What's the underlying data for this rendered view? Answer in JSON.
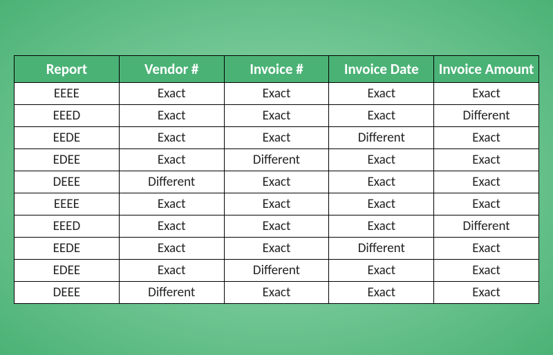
{
  "chart_data": {
    "type": "table",
    "title": "",
    "columns": [
      "Report",
      "Vendor #",
      "Invoice #",
      "Invoice Date",
      "Invoice Amount"
    ],
    "rows": [
      [
        "EEEE",
        "Exact",
        "Exact",
        "Exact",
        "Exact"
      ],
      [
        "EEED",
        "Exact",
        "Exact",
        "Exact",
        "Different"
      ],
      [
        "EEDE",
        "Exact",
        "Exact",
        "Different",
        "Exact"
      ],
      [
        "EDEE",
        "Exact",
        "Different",
        "Exact",
        "Exact"
      ],
      [
        "DEEE",
        "Different",
        "Exact",
        "Exact",
        "Exact"
      ],
      [
        "EEEE",
        "Exact",
        "Exact",
        "Exact",
        "Exact"
      ],
      [
        "EEED",
        "Exact",
        "Exact",
        "Exact",
        "Different"
      ],
      [
        "EEDE",
        "Exact",
        "Exact",
        "Different",
        "Exact"
      ],
      [
        "EDEE",
        "Exact",
        "Different",
        "Exact",
        "Exact"
      ],
      [
        "DEEE",
        "Different",
        "Exact",
        "Exact",
        "Exact"
      ]
    ]
  }
}
